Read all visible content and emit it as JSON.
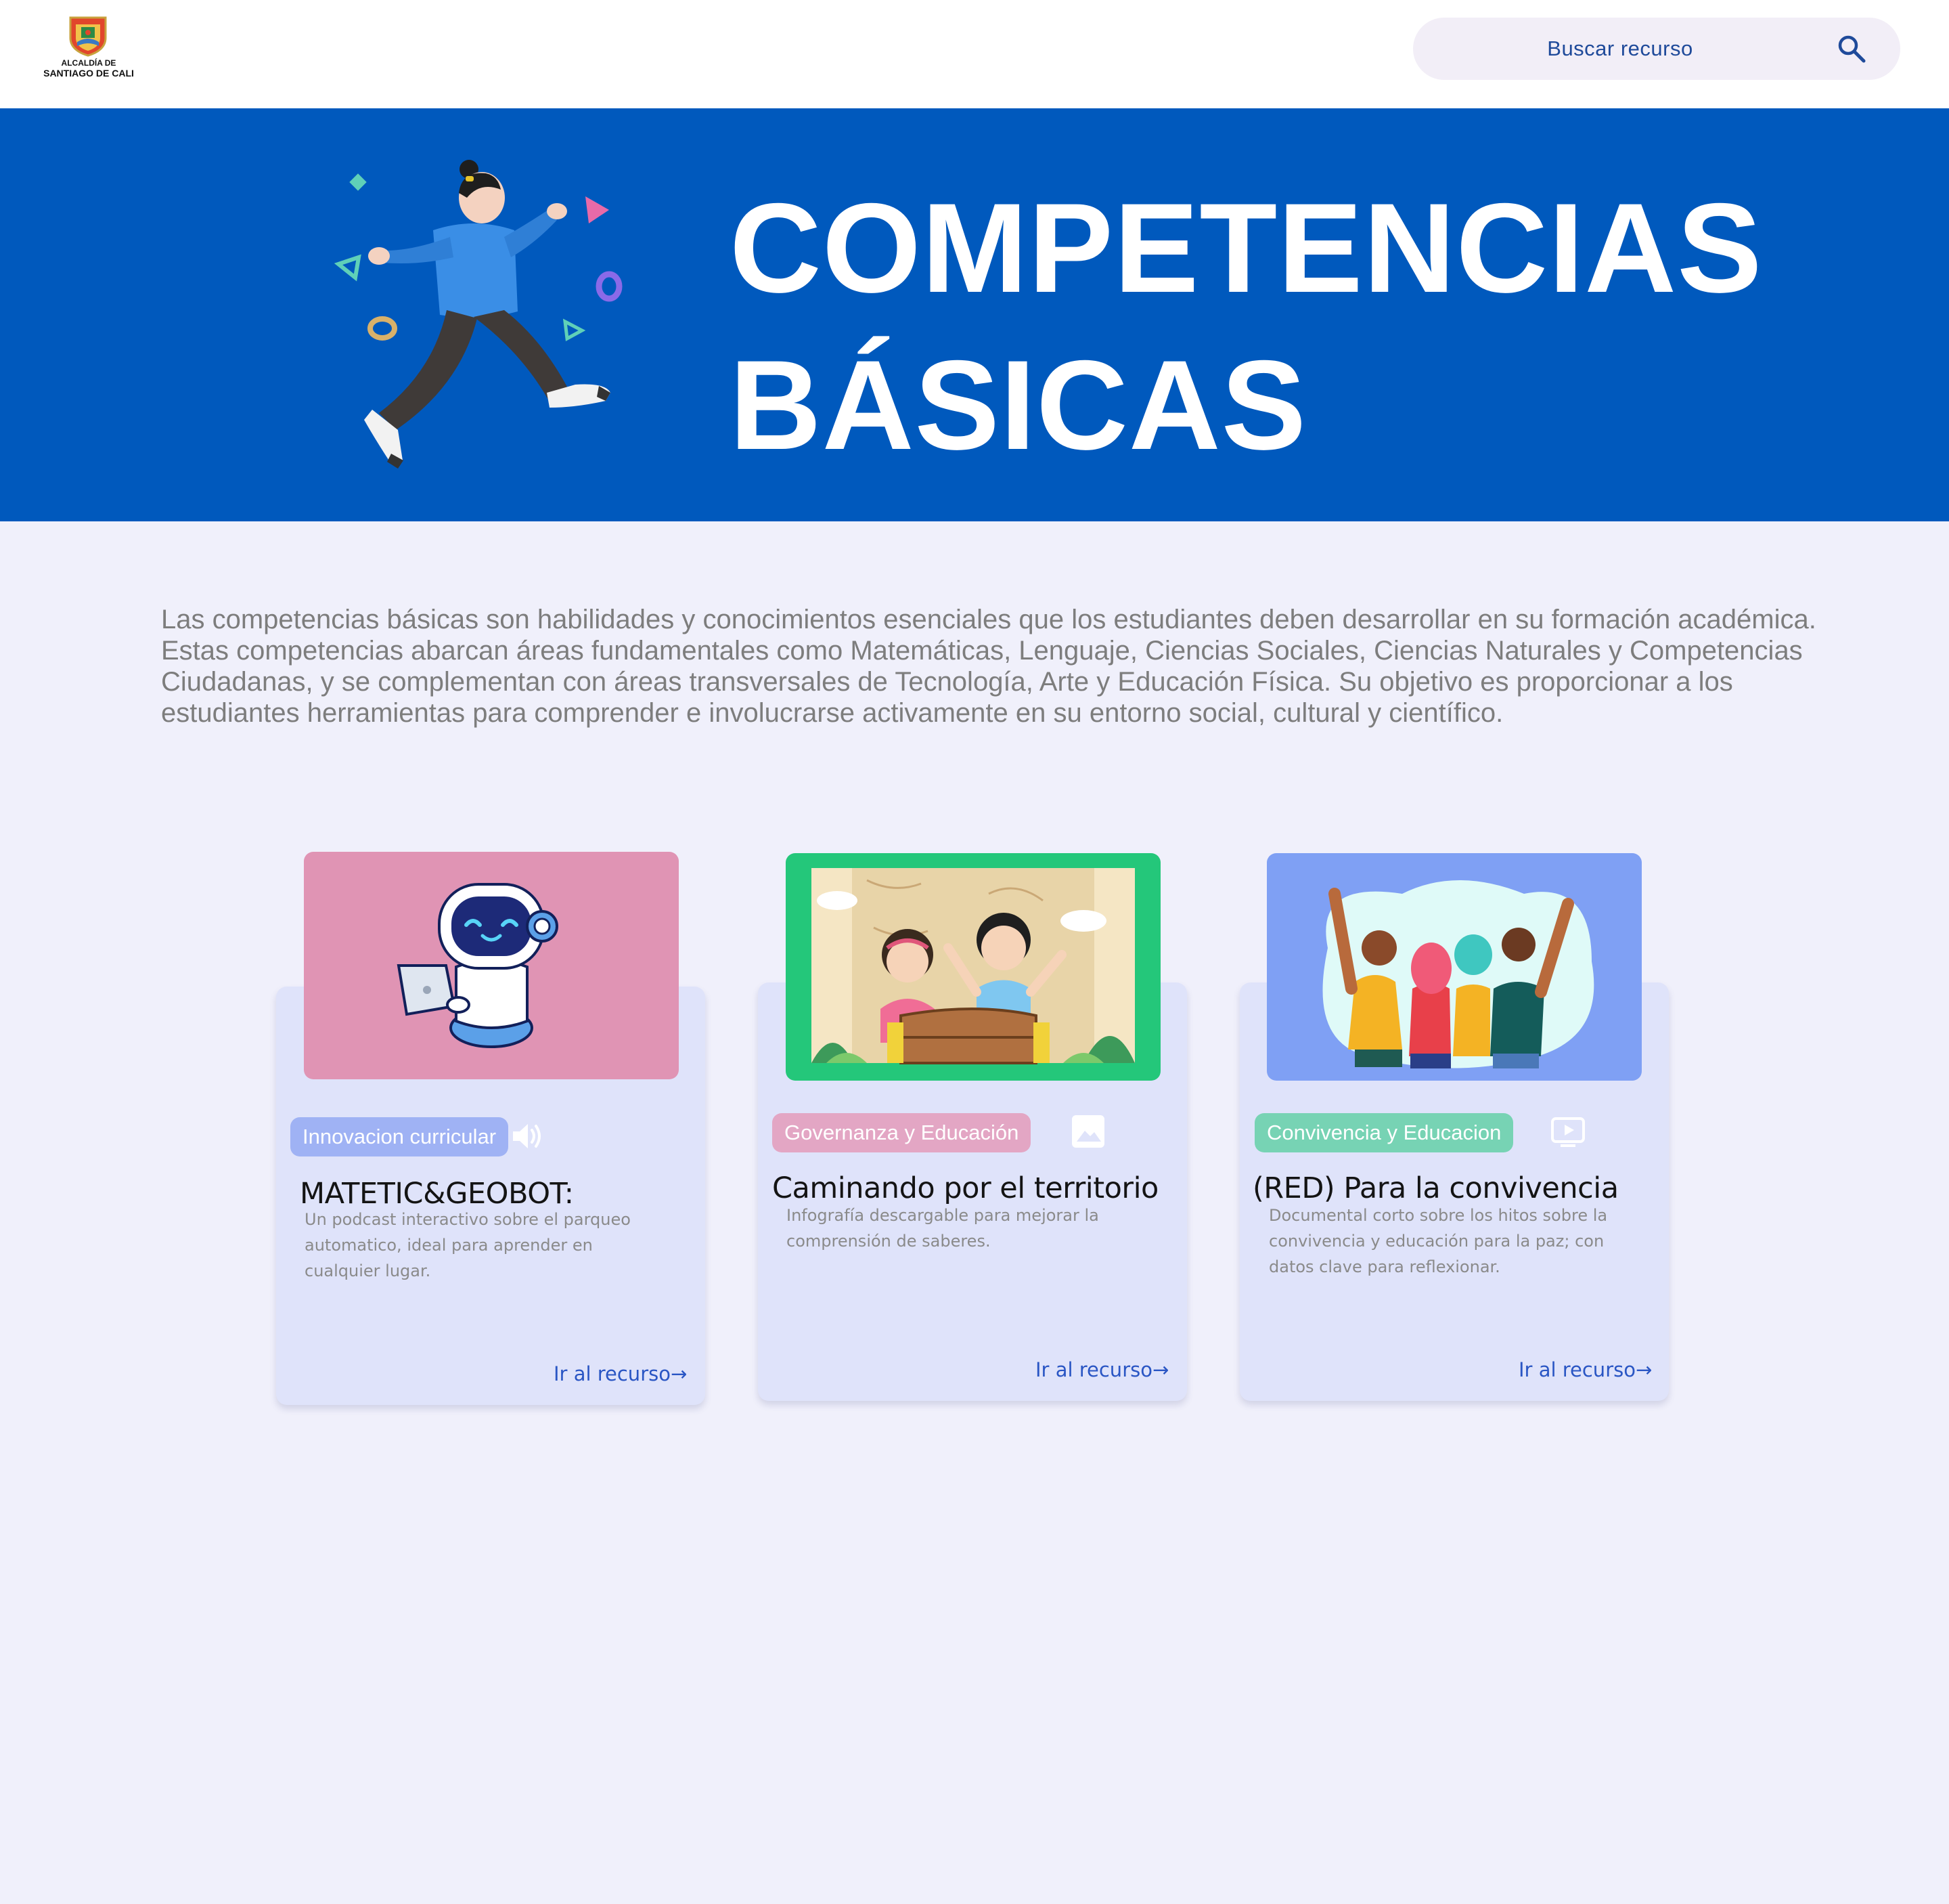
{
  "header": {
    "logo": {
      "line1": "ALCALDÍA DE",
      "line2": "SANTIAGO DE CALI"
    },
    "search": {
      "placeholder": "Buscar recurso",
      "icon": "search-icon"
    }
  },
  "hero": {
    "title_line1": "COMPETENCIAS",
    "title_line2": "BÁSICAS",
    "background": "#0059bd"
  },
  "intro": {
    "text": "Las competencias básicas  son habilidades y conocimientos esenciales que los estudiantes deben desarrollar en su formación académica. Estas competencias abarcan áreas fundamentales como Matemáticas, Lenguaje, Ciencias Sociales, Ciencias Naturales y Competencias Ciudadanas, y se complementan con áreas transversales de Tecnología, Arte y Educación Física. Su objetivo es proporcionar a los estudiantes herramientas para comprender e involucrarse activamente en su entorno social, cultural y científico."
  },
  "cards": [
    {
      "tag": "Innovacion curricular",
      "tag_color": "#9fb2f4",
      "media_icon": "audio-icon",
      "title": "MATETIC&GEOBOT:",
      "description": "Un podcast interactivo sobre el parqueo automatico, ideal para aprender en cualquier lugar.",
      "link": "Ir al recurso→",
      "image": "robot-illustration"
    },
    {
      "tag": "Governanza y Educación",
      "tag_color": "#e3a6c4",
      "media_icon": "image-icon",
      "title": "Caminando por el territorio",
      "description": "Infografía descargable para mejorar la comprensión de saberes.",
      "link": "Ir al recurso→",
      "image": "children-map-illustration"
    },
    {
      "tag": "Convivencia y Educacion",
      "tag_color": "#77d3b4",
      "media_icon": "video-icon",
      "title": "(RED) Para la convivencia",
      "description": "Documental corto sobre los hitos sobre la convivencia y educación para la paz; con datos clave para reflexionar.",
      "link": "Ir al recurso→",
      "image": "friends-group-illustration"
    }
  ]
}
